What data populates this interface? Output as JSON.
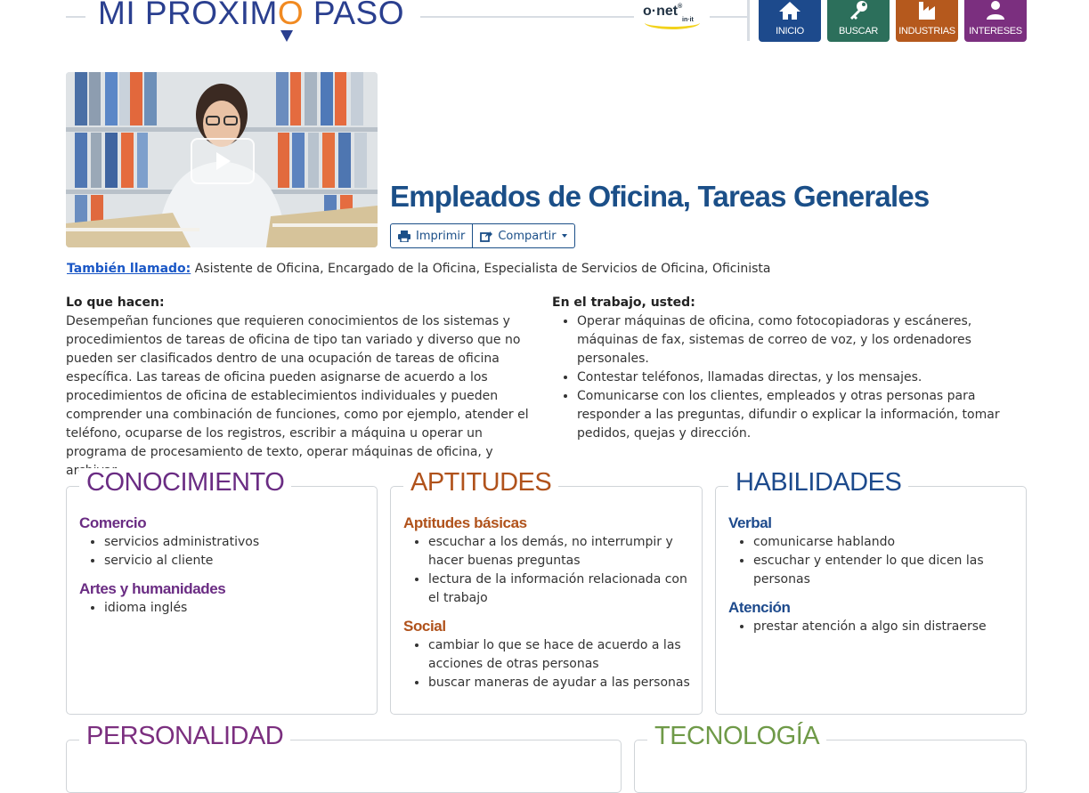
{
  "header": {
    "logo_text_before": "MI PRÓXIM",
    "logo_letter": "O",
    "logo_text_after": " PASO",
    "onet_brand": "o·net",
    "onet_suffix": "in·it",
    "nav": [
      {
        "label": "INICIO",
        "icon": "home-icon",
        "color": "#1d4a8c"
      },
      {
        "label": "BUSCAR",
        "icon": "key-icon",
        "color": "#2c6f5b"
      },
      {
        "label": "INDUSTRIAS",
        "icon": "factory-icon",
        "color": "#b5591d"
      },
      {
        "label": "INTERESES",
        "icon": "person-icon",
        "color": "#7b2f7f"
      }
    ]
  },
  "video": {
    "play_icon": "play-icon"
  },
  "occupation": {
    "title": "Empleados de Oficina, Tareas Generales",
    "print_label": "Imprimir",
    "share_label": "Compartir",
    "also_called_label": "También llamado:",
    "also_called": "Asistente de Oficina, Encargado de la Oficina, Especialista de Servicios de Oficina, Oficinista"
  },
  "what_they_do": {
    "heading": "Lo que hacen:",
    "text": "Desempeñan funciones que requieren conocimientos de los sistemas y procedimientos de tareas de oficina de tipo tan variado y diverso que no pueden ser clasificados dentro de una ocupación de tareas de oficina específica. Las tareas de oficina pueden asignarse de acuerdo a los procedimientos de oficina de establecimientos individuales y pueden comprender una combinación de funciones, como por ejemplo, atender el teléfono, ocuparse de los registros, escribir a máquina u operar un programa de procesamiento de texto, operar máquinas de oficina, y archivar."
  },
  "on_the_job": {
    "heading": "En el trabajo, usted:",
    "items": [
      "Operar máquinas de oficina, como fotocopiadoras y escáneres, máquinas de fax, sistemas de correo de voz, y los ordenadores personales.",
      "Contestar teléfonos, llamadas directas, y los mensajes.",
      "Comunicarse con los clientes, empleados y otras personas para responder a las preguntas, difundir o explicar la información, tomar pedidos, quejas y dirección."
    ]
  },
  "cards": {
    "knowledge": {
      "title": "CONOCIMIENTO",
      "color": "#6a2c83",
      "groups": [
        {
          "name": "Comercio",
          "items": [
            "servicios administrativos",
            "servicio al cliente"
          ]
        },
        {
          "name": "Artes y humanidades",
          "items": [
            "idioma inglés"
          ]
        }
      ]
    },
    "aptitudes": {
      "title": "APTITUDES",
      "color": "#b0521b",
      "groups": [
        {
          "name": "Aptitudes básicas",
          "items": [
            "escuchar a los demás, no interrumpir y hacer buenas preguntas",
            "lectura de la información relacionada con el trabajo"
          ]
        },
        {
          "name": "Social",
          "items": [
            "cambiar lo que se hace de acuerdo a las acciones de otras personas",
            "buscar maneras de ayudar a las personas"
          ]
        }
      ]
    },
    "skills": {
      "title": "HABILIDADES",
      "color": "#1d4a8c",
      "groups": [
        {
          "name": "Verbal",
          "items": [
            "comunicarse hablando",
            "escuchar y entender lo que dicen las personas"
          ]
        },
        {
          "name": "Atención",
          "items": [
            "prestar atención a algo sin distraerse"
          ]
        }
      ]
    },
    "personality": {
      "title": "PERSONALIDAD",
      "color": "#7b2f7f"
    },
    "technology": {
      "title": "TECNOLOGÍA",
      "color": "#6f9a48"
    }
  }
}
